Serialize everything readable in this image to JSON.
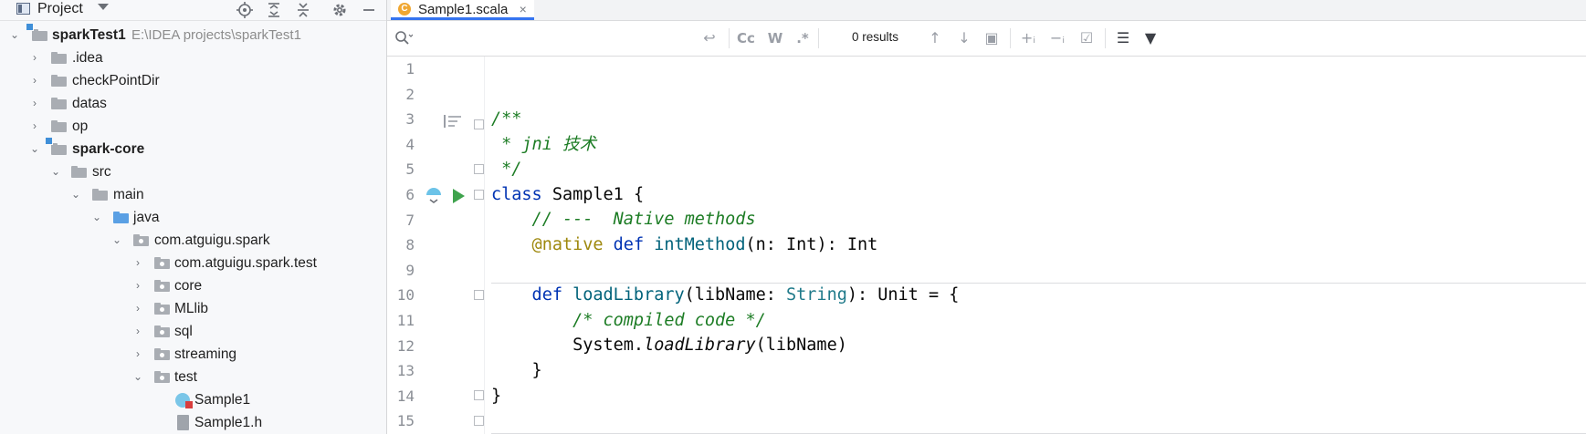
{
  "project_panel": {
    "title": "Project",
    "header_icons": [
      "locate-icon",
      "expand-all-icon",
      "collapse-all-icon",
      "gear-icon",
      "minimize-icon"
    ],
    "tree": [
      {
        "label": "sparkTest1",
        "path": "E:\\IDEA projects\\sparkTest1",
        "bold": true,
        "expanded": true
      },
      {
        "label": ".idea"
      },
      {
        "label": "checkPointDir"
      },
      {
        "label": "datas"
      },
      {
        "label": "op"
      },
      {
        "label": "spark-core",
        "bold": true,
        "expanded": true
      },
      {
        "label": "src",
        "expanded": true
      },
      {
        "label": "main",
        "expanded": true
      },
      {
        "label": "java",
        "expanded": true
      },
      {
        "label": "com.atguigu.spark",
        "expanded": true
      },
      {
        "label": "com.atguigu.spark.test"
      },
      {
        "label": "core"
      },
      {
        "label": "MLlib"
      },
      {
        "label": "sql"
      },
      {
        "label": "streaming"
      },
      {
        "label": "test",
        "expanded": true
      },
      {
        "label": "Sample1"
      },
      {
        "label": "Sample1.h"
      }
    ]
  },
  "editor": {
    "tab_label": "Sample1.scala",
    "tab_icon_letter": "C",
    "tab_close": "×",
    "search": {
      "placeholder": "",
      "results": "0 results",
      "buttons": [
        "Cc",
        "W",
        ".*"
      ]
    },
    "line_numbers": [
      "1",
      "2",
      "3",
      "4",
      "5",
      "6",
      "7",
      "8",
      "9",
      "10",
      "11",
      "12",
      "13",
      "14",
      "15"
    ],
    "code": {
      "l3": "/**",
      "l4": " * jni 技术",
      "l5": " */",
      "l6_kw": "class",
      "l6_rest": " Sample1 {",
      "l7": "    // ---  Native methods",
      "l8_anno": "    @native",
      "l8_kw": " def",
      "l8_fn": " intMethod",
      "l8_rest": "(n: Int): Int",
      "l10_kw": "    def",
      "l10_fn": " loadLibrary",
      "l10_a": "(libName: ",
      "l10_type": "String",
      "l10_b": "): Unit = {",
      "l11": "        /* compiled code */",
      "l12_a": "        System.",
      "l12_italic": "loadLibrary",
      "l12_b": "(libName)",
      "l13": "    }",
      "l14": "}"
    }
  },
  "colors": {
    "keyword": "#0033b3",
    "comment": "#1c7c24",
    "annotation": "#9e880d",
    "function": "#00627a",
    "tab_accent": "#3574f0"
  }
}
